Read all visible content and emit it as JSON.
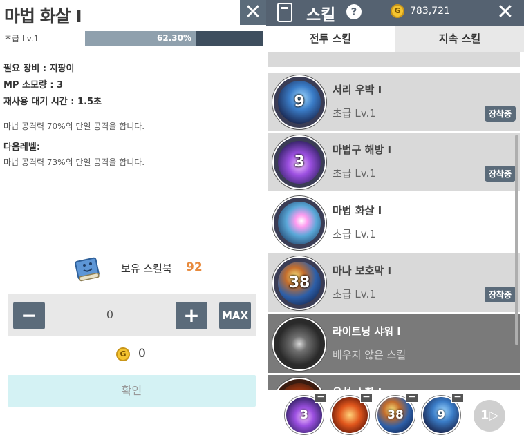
{
  "detail": {
    "title": "마법 화살 I",
    "close_label": "✕",
    "grade_label": "초급 Lv.1",
    "exp_percent_text": "62.30%",
    "exp_fraction": 0.623,
    "equipment_line": "필요 장비 : 지팡이",
    "mp_line": "MP 소모량 : 3",
    "cooldown_line": "재사용 대기 시간 : 1.5초",
    "current_desc": "마법 공격력 70%의 단일 공격을 합니다.",
    "next_level_label": "다음레벨:",
    "next_desc": "마법 공격력 73%의 단일 공격을 합니다.",
    "skillbook_label": "보유 스킬북",
    "skillbook_count": "92",
    "minus_label": "−",
    "plus_label": "+",
    "max_label": "MAX",
    "count_value": "0",
    "gold_symbol": "G",
    "cost_value": "0",
    "confirm_label": "확인"
  },
  "panel": {
    "title": "스킬",
    "help_label": "?",
    "gold_symbol": "G",
    "gold_amount": "783,721",
    "close_label": "✕",
    "tabs": [
      {
        "label": "전투 스킬",
        "active": true
      },
      {
        "label": "지속 스킬",
        "active": false
      }
    ],
    "skills": [
      {
        "name": "서리 우박 I",
        "level": "초급 Lv.1",
        "cooldown": "9",
        "badge": "장착중",
        "state": "equipped"
      },
      {
        "name": "마법구 해방 I",
        "level": "초급 Lv.1",
        "cooldown": "3",
        "badge": "장착중",
        "state": "equipped"
      },
      {
        "name": "마법 화살 I",
        "level": "초급 Lv.1",
        "cooldown": "",
        "badge": "",
        "state": "selected"
      },
      {
        "name": "마나 보호막 I",
        "level": "초급 Lv.1",
        "cooldown": "38",
        "badge": "장착중",
        "state": "equipped"
      },
      {
        "name": "라이트닝 샤워 I",
        "level": "배우지 않은 스킬",
        "cooldown": "",
        "badge": "",
        "state": "locked"
      },
      {
        "name": "유성 소환 I",
        "level": "",
        "cooldown": "",
        "badge": "",
        "state": "locked"
      }
    ],
    "slots": [
      {
        "cooldown": "3",
        "remove_label": "−"
      },
      {
        "cooldown": "",
        "remove_label": "−"
      },
      {
        "cooldown": "38",
        "remove_label": "−"
      },
      {
        "cooldown": "9",
        "remove_label": "−"
      }
    ],
    "next_label": "1▷"
  },
  "colors": {
    "header_bg": "#556271",
    "button_bg": "#5b6b7a",
    "exp_track": "#3e4e5e",
    "exp_fill": "#8fa0ad",
    "skillbook_count": "#e88a3c",
    "confirm_bg": "#d4f2f4",
    "gold": "#f4c430"
  }
}
